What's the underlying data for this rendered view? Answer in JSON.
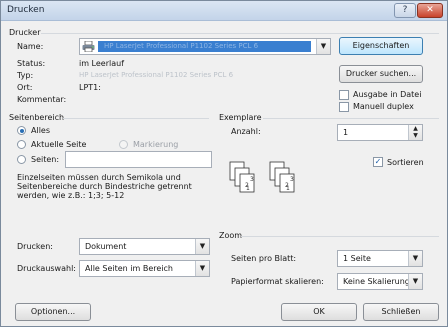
{
  "window": {
    "title": "Drucken",
    "help_glyph": "?",
    "close_glyph": "✕"
  },
  "printer": {
    "section_title": "Drucker",
    "name_label": "Name:",
    "name_value": "HP LaserJet Professional P1102 Series PCL 6",
    "properties_button": "Eigenschaften",
    "status_label": "Status:",
    "status_value": "im Leerlauf",
    "type_label": "Typ:",
    "type_value": "HP LaserJet Professional P1102 Series PCL 6",
    "where_label": "Ort:",
    "where_value": "LPT1:",
    "comment_label": "Kommentar:",
    "find_printer_button": "Drucker suchen...",
    "print_to_file_label": "Ausgabe in Datei",
    "manual_duplex_label": "Manuell duplex"
  },
  "page_range": {
    "section_title": "Seitenbereich",
    "all_label": "Alles",
    "current_label": "Aktuelle Seite",
    "selection_label": "Markierung",
    "pages_label": "Seiten:",
    "pages_value": "",
    "help_text_1": "Einzelseiten müssen durch Semikola und",
    "help_text_2": "Seitenbereiche durch Bindestriche getrennt",
    "help_text_3": "werden, wie z.B.: 1;3; 5-12"
  },
  "copies": {
    "section_title": "Exemplare",
    "count_label": "Anzahl:",
    "count_value": "1",
    "collate_label": "Sortieren",
    "collate_checked": true
  },
  "print_what": {
    "print_label": "Drucken:",
    "print_value": "Dokument",
    "print_options_label": "Druckauswahl:",
    "print_options_value": "Alle Seiten im Bereich"
  },
  "zoom": {
    "section_title": "Zoom",
    "pages_per_sheet_label": "Seiten pro Blatt:",
    "pages_per_sheet_value": "1 Seite",
    "scale_label": "Papierformat skalieren:",
    "scale_value": "Keine Skalierung"
  },
  "footer": {
    "options_button": "Optionen...",
    "ok_button": "OK",
    "close_button": "Schließen"
  },
  "icons": {
    "printer": "printer-icon",
    "dropdown": "chevron-down-icon",
    "spinner": "spinner-icon"
  }
}
